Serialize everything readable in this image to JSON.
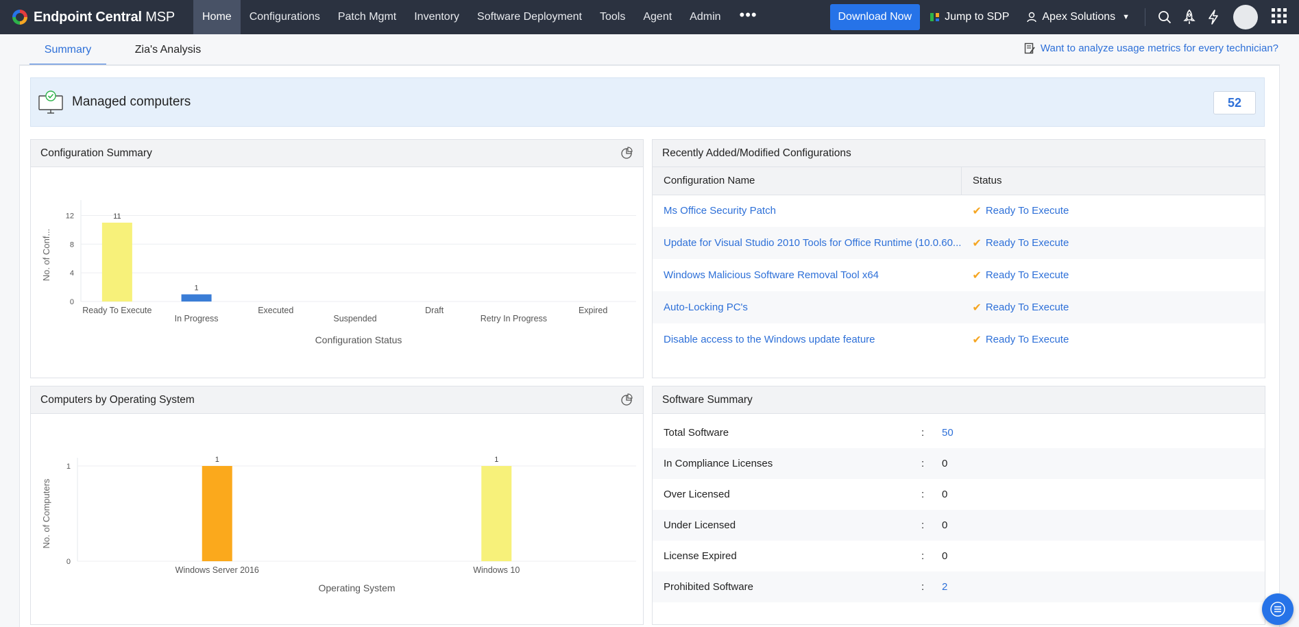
{
  "app": {
    "brand": "Endpoint Central",
    "brand_suffix": " MSP"
  },
  "nav": {
    "items": [
      "Home",
      "Configurations",
      "Patch Mgmt",
      "Inventory",
      "Software Deployment",
      "Tools",
      "Agent",
      "Admin"
    ],
    "more": "•••"
  },
  "topbar": {
    "download_label": "Download Now",
    "jump_label": "Jump to SDP",
    "org_name": "Apex Solutions"
  },
  "tabs": [
    "Summary",
    "Zia's Analysis"
  ],
  "analyze_link": "Want to analyze usage metrics for every technician?",
  "managed": {
    "label": "Managed computers",
    "count": "52"
  },
  "config_summary": {
    "title": "Configuration Summary",
    "chart_data": {
      "type": "bar",
      "categories": [
        "Ready To Execute",
        "In Progress",
        "Executed",
        "Suspended",
        "Draft",
        "Retry In Progress",
        "Expired"
      ],
      "values": [
        11,
        1,
        0,
        0,
        0,
        0,
        0
      ],
      "colors": [
        "#f7f17a",
        "#3a7dd6"
      ],
      "xlabel": "Configuration Status",
      "ylabel": "No. of Conf...",
      "yticks": [
        0,
        4,
        8,
        12
      ],
      "ylim": [
        0,
        13
      ]
    }
  },
  "recent_configs": {
    "title": "Recently Added/Modified Configurations",
    "columns": [
      "Configuration Name",
      "Status"
    ],
    "rows": [
      {
        "name": "Ms Office Security Patch",
        "status": "Ready To Execute"
      },
      {
        "name": "Update for Visual Studio 2010 Tools for Office Runtime (10.0.60...",
        "status": "Ready To Execute"
      },
      {
        "name": "Windows Malicious Software Removal Tool x64",
        "status": "Ready To Execute"
      },
      {
        "name": "Auto-Locking PC's",
        "status": "Ready To Execute"
      },
      {
        "name": "Disable access to the Windows update feature",
        "status": "Ready To Execute"
      }
    ]
  },
  "computers_by_os": {
    "title": "Computers by Operating System",
    "chart_data": {
      "type": "bar",
      "categories": [
        "Windows Server 2016",
        "Windows 10"
      ],
      "values": [
        1,
        1
      ],
      "colors": [
        "#fba91c",
        "#f7f17a"
      ],
      "xlabel": "Operating System",
      "ylabel": "No. of Computers",
      "yticks": [
        0,
        1
      ],
      "ylim": [
        0,
        1
      ]
    }
  },
  "software_summary": {
    "title": "Software Summary",
    "rows": [
      {
        "label": "Total Software",
        "value": "50",
        "link": true
      },
      {
        "label": "In Compliance Licenses",
        "value": "0",
        "link": false
      },
      {
        "label": "Over Licensed",
        "value": "0",
        "link": false
      },
      {
        "label": "Under Licensed",
        "value": "0",
        "link": false
      },
      {
        "label": "License Expired",
        "value": "0",
        "link": false
      },
      {
        "label": "Prohibited Software",
        "value": "2",
        "link": true
      }
    ]
  }
}
